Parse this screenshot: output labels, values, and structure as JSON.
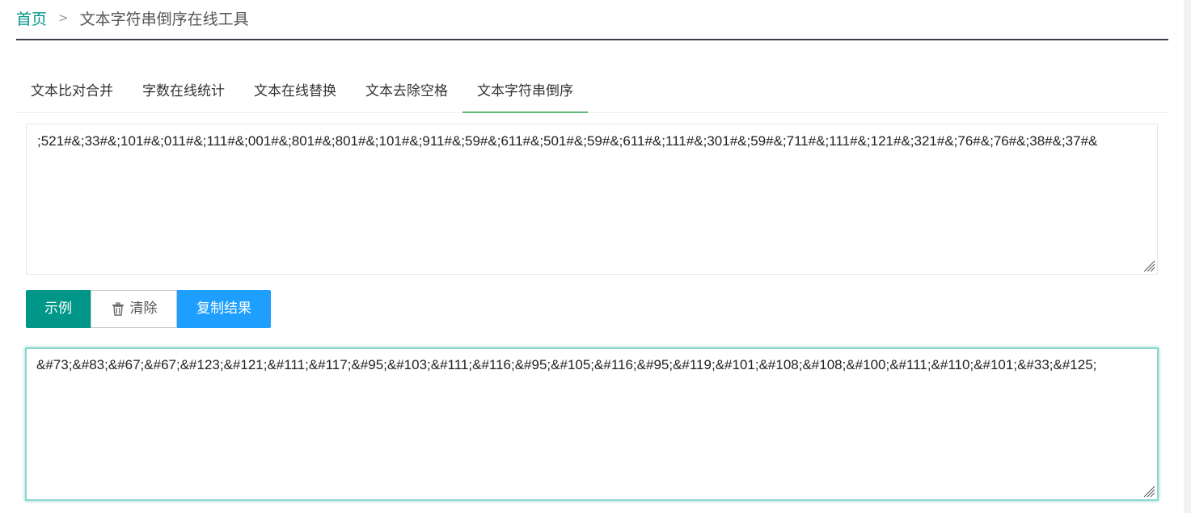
{
  "breadcrumb": {
    "home": "首页",
    "separator": ">",
    "current": "文本字符串倒序在线工具"
  },
  "tabs": [
    {
      "label": "文本比对合并",
      "active": false
    },
    {
      "label": "字数在线统计",
      "active": false
    },
    {
      "label": "文本在线替换",
      "active": false
    },
    {
      "label": "文本去除空格",
      "active": false
    },
    {
      "label": "文本字符串倒序",
      "active": true
    }
  ],
  "input": {
    "value": ";521#&;33#&;101#&;011#&;111#&;001#&;801#&;801#&;101#&;911#&;59#&;611#&;501#&;59#&;611#&;111#&;301#&;59#&;711#&;111#&;121#&;321#&;76#&;76#&;38#&;37#&"
  },
  "buttons": {
    "example": "示例",
    "clear": "清除",
    "copy": "复制结果"
  },
  "output": {
    "value": "&#73;&#83;&#67;&#67;&#123;&#121;&#111;&#117;&#95;&#103;&#111;&#116;&#95;&#105;&#116;&#95;&#119;&#101;&#108;&#108;&#100;&#111;&#110;&#101;&#33;&#125;"
  },
  "colors": {
    "primary": "#009688",
    "blue": "#1e9fff",
    "tab_active_underline": "#5fb878",
    "breadcrumb_line": "#393d49"
  },
  "icons": {
    "clear": "trash-icon",
    "resize": "resize-handle-icon"
  }
}
